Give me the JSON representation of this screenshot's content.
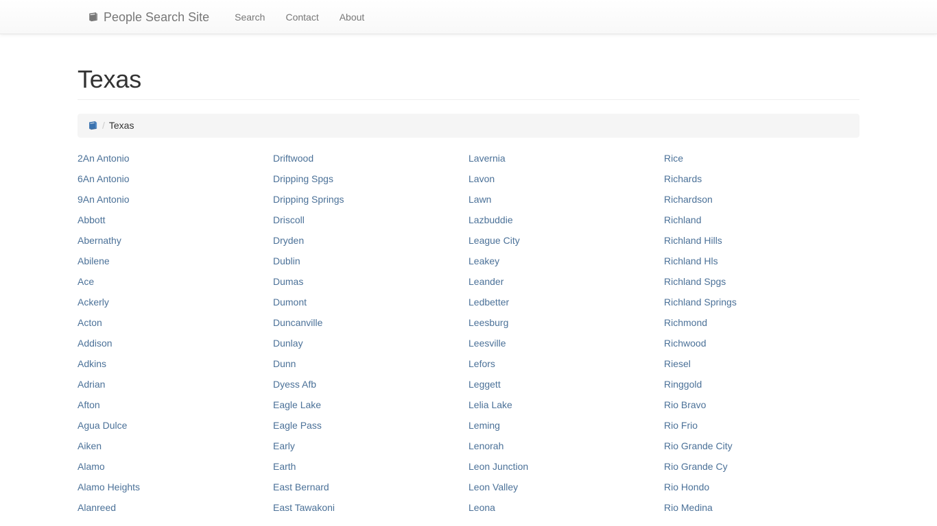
{
  "navbar": {
    "brand": "People Search Site",
    "brand_icon": "book-icon",
    "links": [
      {
        "label": "Search",
        "name": "nav-link-search"
      },
      {
        "label": "Contact",
        "name": "nav-link-contact"
      },
      {
        "label": "About",
        "name": "nav-link-about"
      }
    ]
  },
  "page": {
    "title": "Texas"
  },
  "breadcrumb": {
    "home_icon": "book-icon",
    "separator": "/",
    "current": "Texas"
  },
  "colors": {
    "link": "#4b7198",
    "nav_text": "#777777",
    "heading": "#333333",
    "breadcrumb_bg": "#f5f5f5",
    "navbar_bg": "#f8f8f8",
    "navbar_border": "#e7e7e7",
    "breadcrumb_icon": "#3b73af"
  },
  "columns": [
    {
      "name": "city-column-1",
      "items": [
        "2An Antonio",
        "6An Antonio",
        "9An Antonio",
        "Abbott",
        "Abernathy",
        "Abilene",
        "Ace",
        "Ackerly",
        "Acton",
        "Addison",
        "Adkins",
        "Adrian",
        "Afton",
        "Agua Dulce",
        "Aiken",
        "Alamo",
        "Alamo Heights",
        "Alanreed"
      ]
    },
    {
      "name": "city-column-2",
      "items": [
        "Driftwood",
        "Dripping Spgs",
        "Dripping Springs",
        "Driscoll",
        "Dryden",
        "Dublin",
        "Dumas",
        "Dumont",
        "Duncanville",
        "Dunlay",
        "Dunn",
        "Dyess Afb",
        "Eagle Lake",
        "Eagle Pass",
        "Early",
        "Earth",
        "East Bernard",
        "East Tawakoni"
      ]
    },
    {
      "name": "city-column-3",
      "items": [
        "Lavernia",
        "Lavon",
        "Lawn",
        "Lazbuddie",
        "League City",
        "Leakey",
        "Leander",
        "Ledbetter",
        "Leesburg",
        "Leesville",
        "Lefors",
        "Leggett",
        "Lelia Lake",
        "Leming",
        "Lenorah",
        "Leon Junction",
        "Leon Valley",
        "Leona"
      ]
    },
    {
      "name": "city-column-4",
      "items": [
        "Rice",
        "Richards",
        "Richardson",
        "Richland",
        "Richland Hills",
        "Richland Hls",
        "Richland Spgs",
        "Richland Springs",
        "Richmond",
        "Richwood",
        "Riesel",
        "Ringgold",
        "Rio Bravo",
        "Rio Frio",
        "Rio Grande City",
        "Rio Grande Cy",
        "Rio Hondo",
        "Rio Medina"
      ]
    }
  ]
}
